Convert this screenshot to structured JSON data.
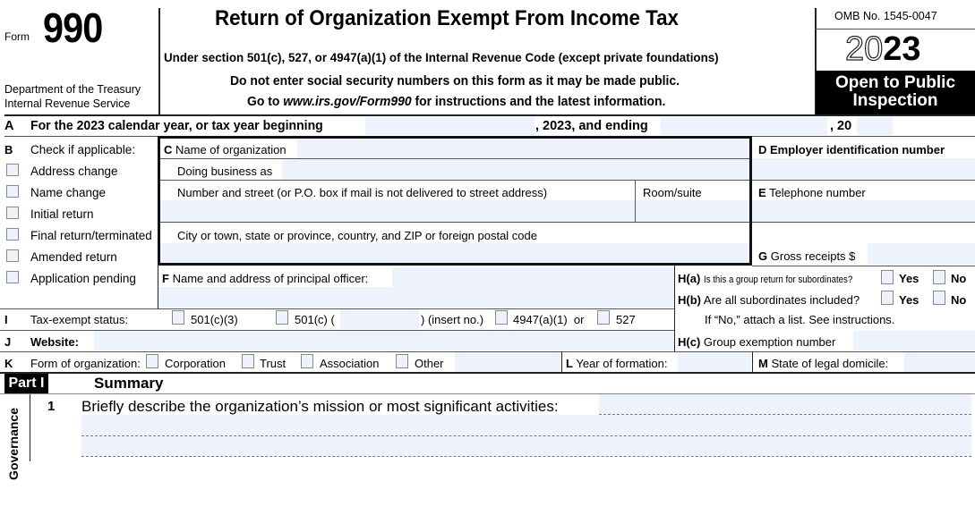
{
  "header": {
    "form_word": "Form",
    "form_number": "990",
    "department": "Department of the Treasury",
    "service": "Internal Revenue Service",
    "title": "Return of Organization Exempt From Income Tax",
    "subtitle": "Under section 501(c), 527, or 4947(a)(1) of the Internal Revenue Code (except private foundations)",
    "notice": "Do not enter social security numbers on this form as it may be made public.",
    "goto_prefix": "Go to ",
    "goto_link": "www.irs.gov/Form990",
    "goto_suffix": " for instructions and the latest information.",
    "omb": "OMB No. 1545-0047",
    "year_outline": "20",
    "year_bold": "23",
    "open_public_line1": "Open to Public",
    "open_public_line2": "Inspection"
  },
  "line_a": {
    "letter": "A",
    "label": "For the 2023 calendar year, or tax year beginning",
    "mid": ", 2023, and ending",
    "end": ", 20",
    "begin_value": "",
    "end_value": "",
    "year_value": ""
  },
  "section_b": {
    "letter": "B",
    "label": "Check if applicable:",
    "items": [
      {
        "label": "Address change",
        "checked": false
      },
      {
        "label": "Name change",
        "checked": false
      },
      {
        "label": "Initial return",
        "checked": false
      },
      {
        "label": "Final return/terminated",
        "checked": false
      },
      {
        "label": "Amended return",
        "checked": false
      },
      {
        "label": "Application pending",
        "checked": false
      }
    ]
  },
  "section_c": {
    "letter": "C",
    "name_label": "Name of organization",
    "dba_label": "Doing business as",
    "street_label": "Number and street (or P.O. box if mail is not delivered to street address)",
    "room_label": "Room/suite",
    "city_label": "City or town, state or province, country, and ZIP or foreign postal code",
    "name_value": "",
    "dba_value": "",
    "street_value": "",
    "room_value": "",
    "city_value": ""
  },
  "section_d": {
    "letter": "D",
    "label": "Employer identification number",
    "value": ""
  },
  "section_e": {
    "letter": "E",
    "label": "Telephone number",
    "value": ""
  },
  "section_g": {
    "letter": "G",
    "label": "Gross receipts $",
    "value": ""
  },
  "section_f": {
    "letter": "F",
    "label": "Name and address of principal officer:",
    "value": ""
  },
  "section_h": {
    "ha_letter": "H(a)",
    "ha_label": "Is this a group return for subordinates?",
    "hb_letter": "H(b)",
    "hb_label": "Are all subordinates included?",
    "hb_note": "If “No,” attach a list. See instructions.",
    "hc_letter": "H(c)",
    "hc_label": "Group exemption number",
    "yes": "Yes",
    "no": "No",
    "hc_value": ""
  },
  "section_i": {
    "letter": "I",
    "label": "Tax-exempt status:",
    "opt1": "501(c)(3)",
    "opt2": "501(c) (",
    "opt2_suffix": ") (insert no.)",
    "opt3": "4947(a)(1)  or",
    "opt4": "527",
    "insert_value": ""
  },
  "section_j": {
    "letter": "J",
    "label": "Website:",
    "value": ""
  },
  "section_k": {
    "letter": "K",
    "label": "Form of organization:",
    "options": [
      "Corporation",
      "Trust",
      "Association",
      "Other"
    ],
    "other_value": ""
  },
  "section_l": {
    "letter": "L",
    "label": "Year of formation:",
    "value": ""
  },
  "section_m": {
    "letter": "M",
    "label": "State of legal domicile:",
    "value": ""
  },
  "part1": {
    "part_label": "Part I",
    "title": "Summary",
    "side_label": "Governance",
    "line1_number": "1",
    "line1_label": "Briefly describe the organization’s mission or most significant activities:"
  }
}
